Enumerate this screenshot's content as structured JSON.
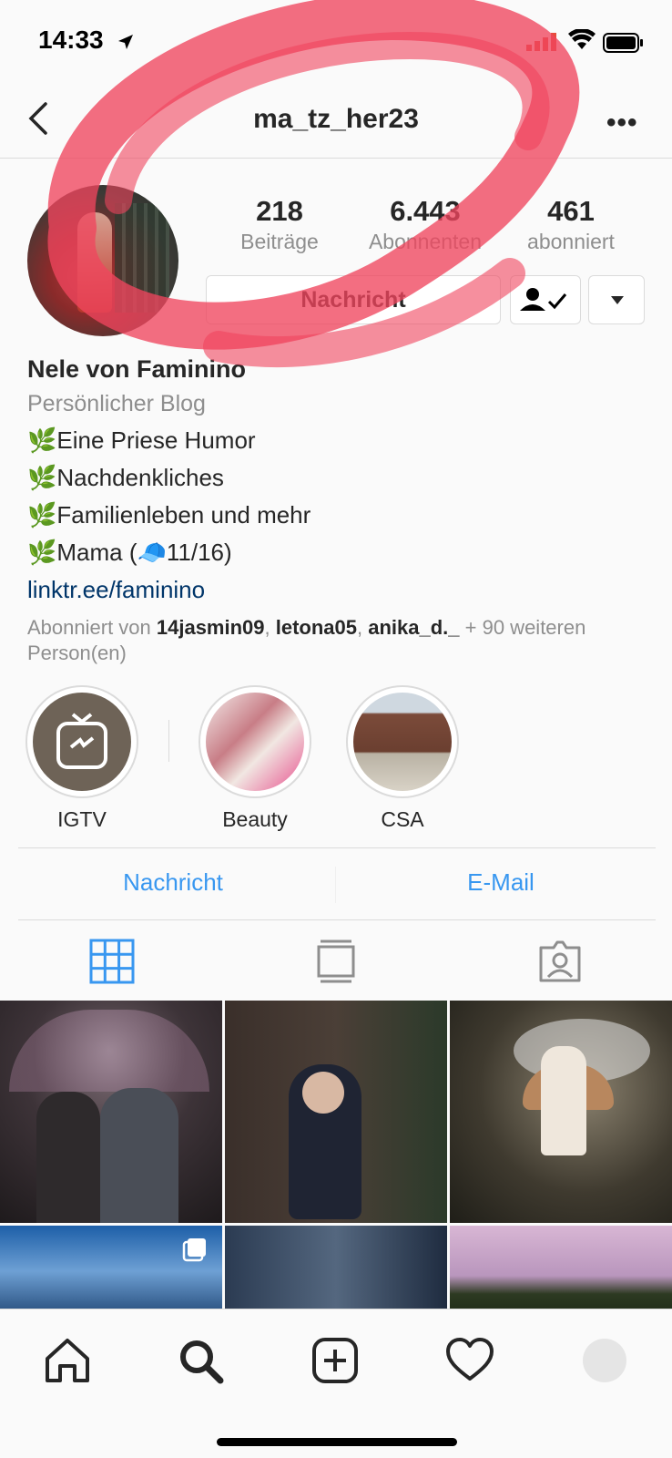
{
  "status_bar": {
    "time": "14:33"
  },
  "header": {
    "username": "ma_tz_her23"
  },
  "stats": [
    {
      "value": "218",
      "label": "Beiträge"
    },
    {
      "value": "6.443",
      "label": "Abonnenten"
    },
    {
      "value": "461",
      "label": "abonniert"
    }
  ],
  "actions": {
    "message_label": "Nachricht"
  },
  "bio": {
    "name": "Nele von Faminino",
    "category": "Persönlicher Blog",
    "lines": [
      "🌿Eine Priese Humor",
      "🌿Nachdenkliches",
      "🌿Familienleben und mehr",
      "🌿Mama (🧢11/16)"
    ],
    "link": "linktr.ee/faminino",
    "followed_prefix": "Abonniert von ",
    "followed_users": [
      "14jasmin09",
      "letona05",
      "anika_d._"
    ],
    "followed_sep": ", ",
    "followed_suffix": " + 90 weiteren Person(en)"
  },
  "highlights": [
    {
      "label": "IGTV"
    },
    {
      "label": "Beauty"
    },
    {
      "label": "CSA"
    }
  ],
  "contact": {
    "message": "Nachricht",
    "email": "E-Mail"
  },
  "colors": {
    "link_blue": "#3897f0",
    "text": "#262626",
    "muted": "#8e8e8e",
    "border": "#dbdbdb",
    "scribble": "#f0455d"
  },
  "icons": [
    "location-arrow-icon",
    "signal-icon",
    "wifi-icon",
    "battery-icon",
    "back-chevron-icon",
    "more-icon",
    "following-check-icon",
    "dropdown-triangle-icon",
    "grid-icon",
    "feed-icon",
    "tagged-icon",
    "home-icon",
    "search-icon",
    "add-icon",
    "heart-icon",
    "profile-avatar-icon",
    "carousel-icon"
  ]
}
